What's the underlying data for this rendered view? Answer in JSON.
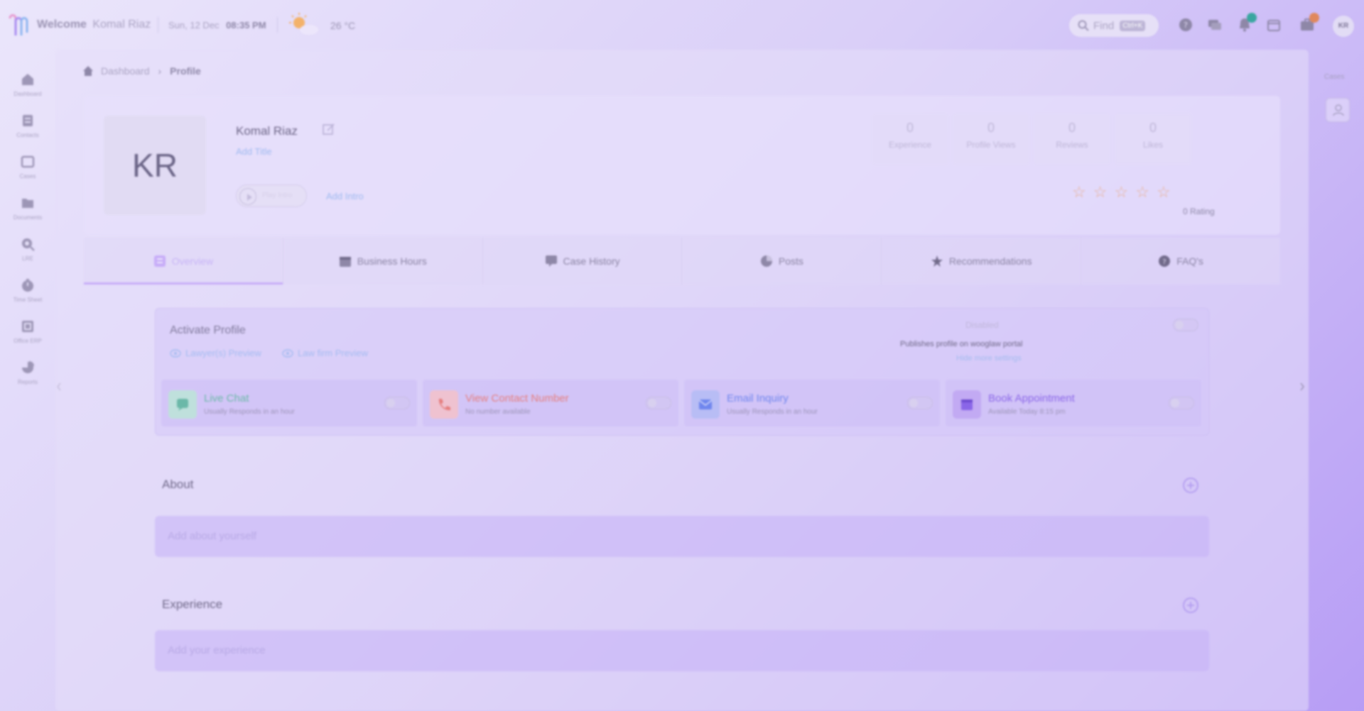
{
  "topbar": {
    "welcome": "Welcome",
    "user_name": "Komal Riaz",
    "date": "Sun, 12 Dec",
    "time": "08:35 PM",
    "temperature": "26 °C",
    "find_label": "Find",
    "find_shortcut": "Ctrl+K",
    "notification_badge_color": "#3aa6a0",
    "cases_badge_color": "#e0885c",
    "avatar_initials": "KR"
  },
  "sidebar": {
    "items": [
      {
        "label": "Dashboard",
        "icon": "home-icon"
      },
      {
        "label": "Contacts",
        "icon": "contacts-icon"
      },
      {
        "label": "Cases",
        "icon": "cases-icon"
      },
      {
        "label": "Documents",
        "icon": "documents-icon"
      },
      {
        "label": "LRE",
        "icon": "search-doc-icon"
      },
      {
        "label": "Time Sheet",
        "icon": "clock-icon"
      },
      {
        "label": "Office ERP",
        "icon": "erp-icon"
      },
      {
        "label": "Reports",
        "icon": "pie-chart-icon"
      }
    ]
  },
  "breadcrumb": {
    "items": [
      "Dashboard",
      "Profile"
    ]
  },
  "profile": {
    "initials": "KR",
    "name": "Komal Riaz",
    "add_title": "Add Title",
    "play_label": "Play Intro",
    "add_intro": "Add Intro",
    "stats": [
      {
        "value": "0",
        "label": "Experience"
      },
      {
        "value": "0",
        "label": "Profile Views"
      },
      {
        "value": "0",
        "label": "Reviews"
      },
      {
        "value": "0",
        "label": "Likes"
      }
    ],
    "stars": 5,
    "rating_value": 0,
    "rating_text": "0  Rating"
  },
  "tabs": [
    {
      "label": "Overview",
      "icon": "overview-icon",
      "active": true
    },
    {
      "label": "Business Hours",
      "icon": "calendar-icon",
      "active": false
    },
    {
      "label": "Case History",
      "icon": "case-history-icon",
      "active": false
    },
    {
      "label": "Posts",
      "icon": "posts-icon",
      "active": false
    },
    {
      "label": "Recommendations",
      "icon": "recommendations-icon",
      "active": false
    },
    {
      "label": "FAQ's",
      "icon": "question-icon",
      "active": false
    }
  ],
  "activate": {
    "title": "Activate Profile",
    "lawyer_preview": "Lawyer(s) Preview",
    "lawfirm_preview": "Law firm Preview",
    "disabled_label": "Disabled",
    "publish_text": "Publishes profile on wooglaw portal",
    "hide_more": "Hide more settings",
    "features": [
      {
        "title": "Live Chat",
        "sub": "Usually Responds in an hour",
        "color": "#6bb8a8",
        "bg": "#bfe0dc",
        "icon": "chat-icon"
      },
      {
        "title": "View Contact Number",
        "sub": "No number available",
        "color": "#e57d7d",
        "bg": "#efc2d0",
        "icon": "phone-icon"
      },
      {
        "title": "Email Inquiry",
        "sub": "Usually Responds in an hour",
        "color": "#6f86ee",
        "bg": "#b8bdf5",
        "icon": "email-icon"
      },
      {
        "title": "Book Appointment",
        "sub": "Available Today 8:15 pm",
        "color": "#8a66e8",
        "bg": "#c2aaf3",
        "icon": "calendar-icon"
      }
    ]
  },
  "about": {
    "title": "About",
    "placeholder": "Add about yourself"
  },
  "experience": {
    "title": "Experience",
    "placeholder": "Add your experience"
  },
  "right_rail": {
    "label": "Cases"
  },
  "colors": {
    "accent": "#a27cf2",
    "link": "#6f9be6",
    "star": "#e39068"
  }
}
